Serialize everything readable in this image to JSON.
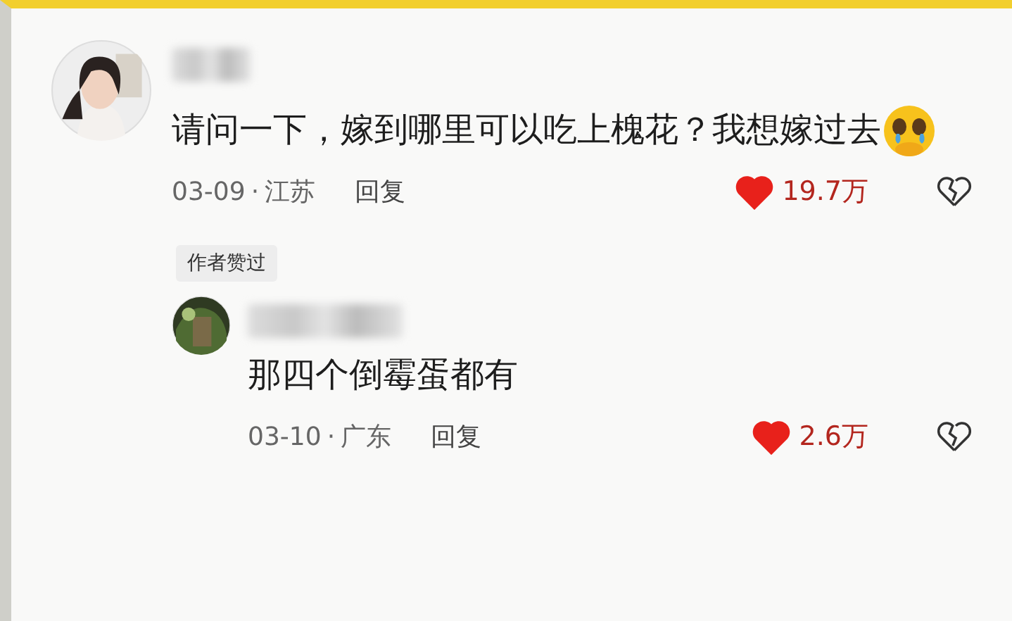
{
  "comments": [
    {
      "content": [
        {
          "kind": "text",
          "text": "请问一下，嫁到哪里可以吃上槐花？我想嫁过去"
        },
        {
          "kind": "crying-emoji"
        }
      ],
      "date": "03-09",
      "separator": "·",
      "region": "江苏",
      "reply_label": "回复",
      "liked": true,
      "likes": "19.7万",
      "author_badge": "作者赞过",
      "replies": [
        {
          "text": "那四个倒霉蛋都有",
          "date": "03-10",
          "separator": "·",
          "region": "广东",
          "reply_label": "回复",
          "liked": true,
          "likes": "2.6万"
        }
      ]
    }
  ]
}
